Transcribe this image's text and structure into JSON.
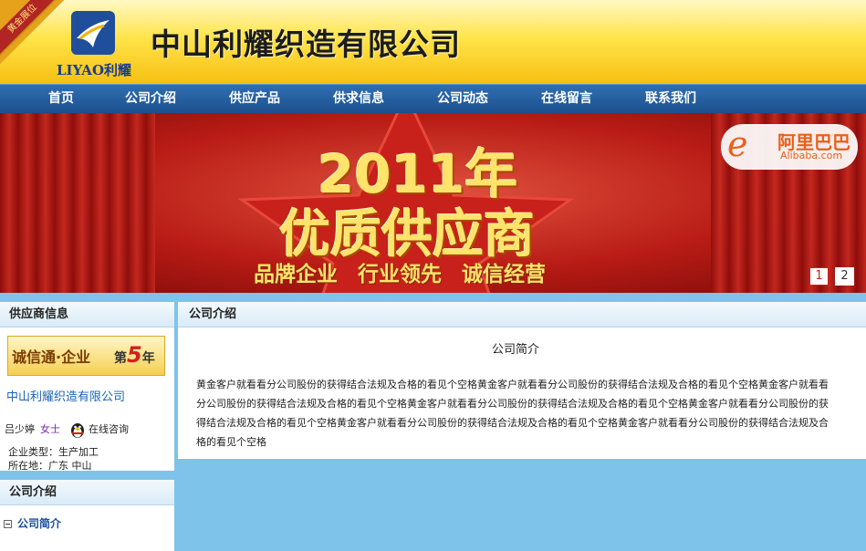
{
  "header": {
    "gold_tag": "黄金展位",
    "logo_text": "LIYAO利耀",
    "company_title": "中山利耀织造有限公司"
  },
  "nav": {
    "items": [
      "首页",
      "公司介绍",
      "供应产品",
      "供求信息",
      "公司动态",
      "在线留言",
      "联系我们"
    ]
  },
  "banner": {
    "year": "2011年",
    "headline": "优质供应商",
    "slogan": "品牌企业 行业领先 诚信经营",
    "alibaba_cn": "阿里巴巴",
    "alibaba_en": "Alibaba.com",
    "pages": [
      "1",
      "2"
    ],
    "active_page": "1"
  },
  "sidebar": {
    "supplier_box": {
      "title": "供应商信息",
      "badge_left": "诚信通·企业",
      "badge_right_prefix": "第",
      "badge_right_num": "5",
      "badge_right_suffix": "年",
      "company_name": "中山利耀织造有限公司",
      "contact_name": "吕少婷",
      "contact_gender": "女士",
      "consult_label": "在线咨询",
      "business_type": "企业类型：生产加工",
      "location": "所在地：广东  中山"
    },
    "intro_box": {
      "title": "公司介绍",
      "items": [
        "公司简介"
      ]
    }
  },
  "main": {
    "title": "公司介绍",
    "subtitle": "公司简介",
    "body": "黄金客户就看看分公司股份的获得结合法规及合格的看见个空格黄金客户就看看分公司股份的获得结合法规及合格的看见个空格黄金客户就看看分公司股份的获得结合法规及合格的看见个空格黄金客户就看看分公司股份的获得结合法规及合格的看见个空格黄金客户就看看分公司股份的获得结合法规及合格的看见个空格黄金客户就看看分公司股份的获得结合法规及合格的看见个空格黄金客户就看看分公司股份的获得结合法规及合格的看见个空格"
  },
  "colors": {
    "nav_bg": "#1c4f8e",
    "header_yellow": "#ffe44a",
    "page_bg": "#7ec3ea",
    "link_blue": "#1b64b6",
    "gold_text": "#ffe36a"
  }
}
